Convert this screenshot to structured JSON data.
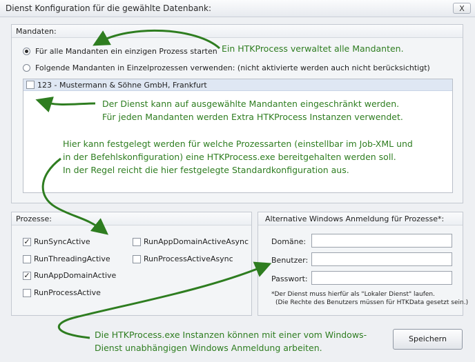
{
  "window": {
    "title": "Dienst Konfiguration für die gewählte Datenbank:",
    "close_label": "X"
  },
  "mandanten": {
    "title": "Mandaten:",
    "option_single": "Für alle Mandanten ein einzigen Prozess starten",
    "option_multi": "Folgende Mandanten in Einzelprozessen verwenden: (nicht aktivierte werden auch nicht berücksichtigt)",
    "selected_option": "option_single",
    "items": [
      {
        "label": "123 - Mustermann & Söhne GmbH, Frankfurt",
        "checked": false
      }
    ]
  },
  "prozesse": {
    "title": "Prozesse:",
    "items": [
      {
        "label": "RunSyncActive",
        "checked": true
      },
      {
        "label": "RunThreadingActive",
        "checked": false
      },
      {
        "label": "RunAppDomainActive",
        "checked": true
      },
      {
        "label": "RunProcessActive",
        "checked": false
      },
      {
        "label": "RunAppDomainActiveAsync",
        "checked": false
      },
      {
        "label": "RunProcessActiveAsync",
        "checked": false
      }
    ]
  },
  "login": {
    "title": "Alternative Windows Anmeldung für Prozesse*:",
    "domain_label": "Domäne:",
    "user_label": "Benutzer:",
    "password_label": "Passwort:",
    "domain_value": "",
    "user_value": "",
    "password_value": "",
    "note_line1": "*Der Dienst muss hierfür als \"Lokaler Dienst\" laufen.",
    "note_line2": "(Die Rechte des Benutzers müssen für HTKData gesetzt sein.)"
  },
  "save_button": "Speichern",
  "annotations": {
    "a1": "Ein HTKProcess verwaltet alle Mandanten.",
    "a2_line1": "Der Dienst kann auf ausgewählte Mandanten eingeschränkt werden.",
    "a2_line2": "Für jeden Mandanten werden Extra HTKProcess Instanzen verwendet.",
    "a3_line1": "Hier kann festgelegt werden für welche Prozessarten (einstellbar im Job-XML und",
    "a3_line2": "in der Befehlskonfiguration) eine HTKProcess.exe bereitgehalten werden soll.",
    "a3_line3": "In der Regel reicht die hier festgelegte Standardkonfiguration aus.",
    "a4_line1": "Die HTKProcess.exe Instanzen können mit einer vom Windows-",
    "a4_line2": "Dienst unabhängigen Windows Anmeldung arbeiten.",
    "color": "#2e7d20"
  }
}
